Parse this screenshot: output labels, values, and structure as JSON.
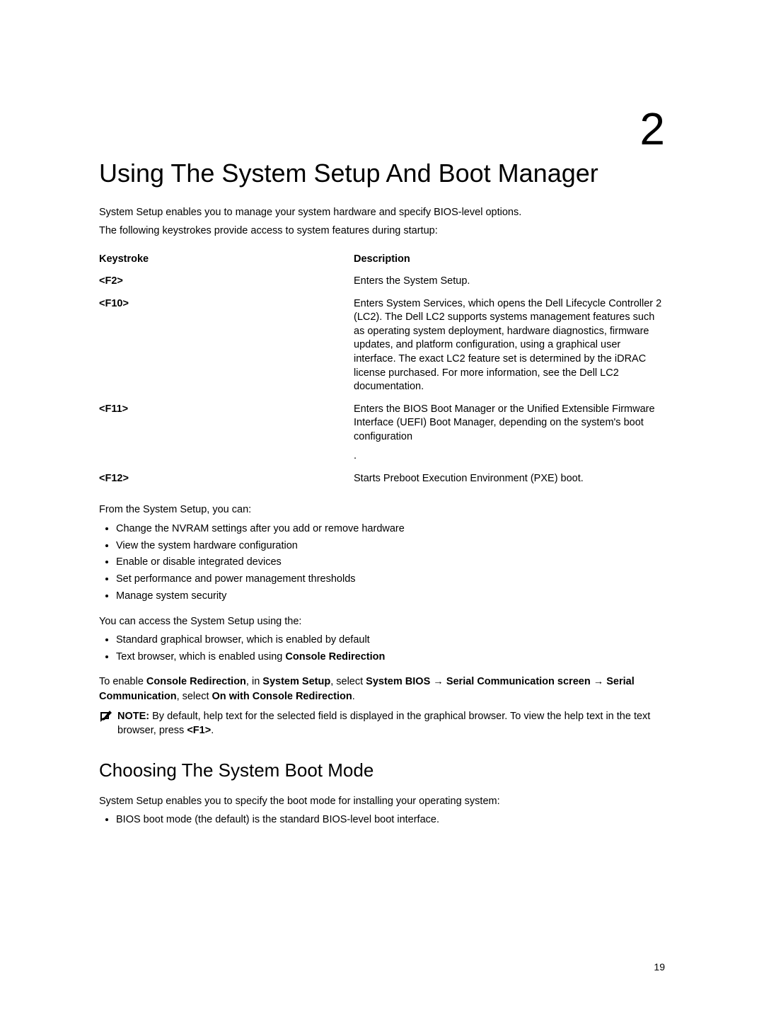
{
  "chapter_number": "2",
  "title": "Using The System Setup And Boot Manager",
  "intro_p1": "System Setup enables you to manage your system hardware and specify BIOS-level options.",
  "intro_p2": "The following keystrokes provide access to system features during startup:",
  "table": {
    "header": {
      "left": "Keystroke",
      "right": "Description"
    },
    "rows": [
      {
        "key": "<F2>",
        "desc": "Enters the System Setup."
      },
      {
        "key": "<F10>",
        "desc": "Enters System Services, which opens the Dell Lifecycle Controller 2 (LC2). The Dell LC2 supports systems management features such as operating system deployment, hardware diagnostics, firmware updates, and platform configuration, using a graphical user interface. The exact LC2 feature set is determined by the iDRAC license purchased. For more information, see the Dell LC2 documentation."
      },
      {
        "key": "<F11>",
        "desc": "Enters the BIOS Boot Manager or the Unified Extensible Firmware Interface (UEFI) Boot Manager, depending on the system's boot configuration",
        "trailing_dot": "."
      },
      {
        "key": "<F12>",
        "desc": "Starts Preboot Execution Environment (PXE) boot."
      }
    ]
  },
  "after_table_p": "From the System Setup, you can:",
  "list1": [
    "Change the NVRAM settings after you add or remove hardware",
    "View the system hardware configuration",
    "Enable or disable integrated devices",
    "Set performance and power management thresholds",
    "Manage system security"
  ],
  "access_p": "You can access the System Setup using the:",
  "list2_item1": "Standard graphical browser, which is enabled by default",
  "list2_item2_pre": "Text browser, which is enabled using ",
  "list2_item2_bold": "Console Redirection",
  "enable_line": {
    "t1": "To enable ",
    "b1": "Console Redirection",
    "t2": ", in ",
    "b2": "System Setup",
    "t3": ", select ",
    "b3": "System BIOS",
    "arrow1": " → ",
    "b4": "Serial Communication screen",
    "arrow2": " → ",
    "b5": "Serial Communication",
    "t4": ", select ",
    "b6": "On with Console Redirection",
    "t5": "."
  },
  "note": {
    "label": "NOTE:",
    "t1": " By default, help text for the selected field is displayed in the graphical browser. To view the help text in the text browser, press ",
    "b1": "<F1>",
    "t2": "."
  },
  "section2_title": "Choosing The System Boot Mode",
  "section2_p": "System Setup enables you to specify the boot mode for installing your operating system:",
  "list3": [
    "BIOS boot mode (the default) is the standard BIOS-level boot interface."
  ],
  "page_number": "19"
}
